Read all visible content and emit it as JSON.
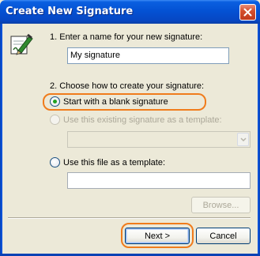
{
  "window": {
    "title": "Create New Signature",
    "close_symbol": "✕"
  },
  "step1": {
    "label": "1. Enter a name for your new signature:",
    "name_value": "My signature"
  },
  "step2": {
    "label": "2. Choose how to create your signature:",
    "options": [
      {
        "label": "Start with a blank signature",
        "selected": true,
        "enabled": true
      },
      {
        "label": "Use this existing signature as a template:",
        "selected": false,
        "enabled": false
      },
      {
        "label": "Use this file as a template:",
        "selected": false,
        "enabled": true
      }
    ],
    "existing_template_value": "",
    "file_path_value": ""
  },
  "buttons": {
    "browse_label": "Browse...",
    "next_label": "Next >",
    "cancel_label": "Cancel"
  },
  "icons": {
    "signature": "signature-pen-icon",
    "close": "close-icon",
    "dropdown": "chevron-down-icon"
  },
  "colors": {
    "titlebar": "#0452d4",
    "dialog_bg": "#ece9d8",
    "highlight": "#f07c1c",
    "radio_selected": "#21a121",
    "disabled_text": "#aca899"
  }
}
